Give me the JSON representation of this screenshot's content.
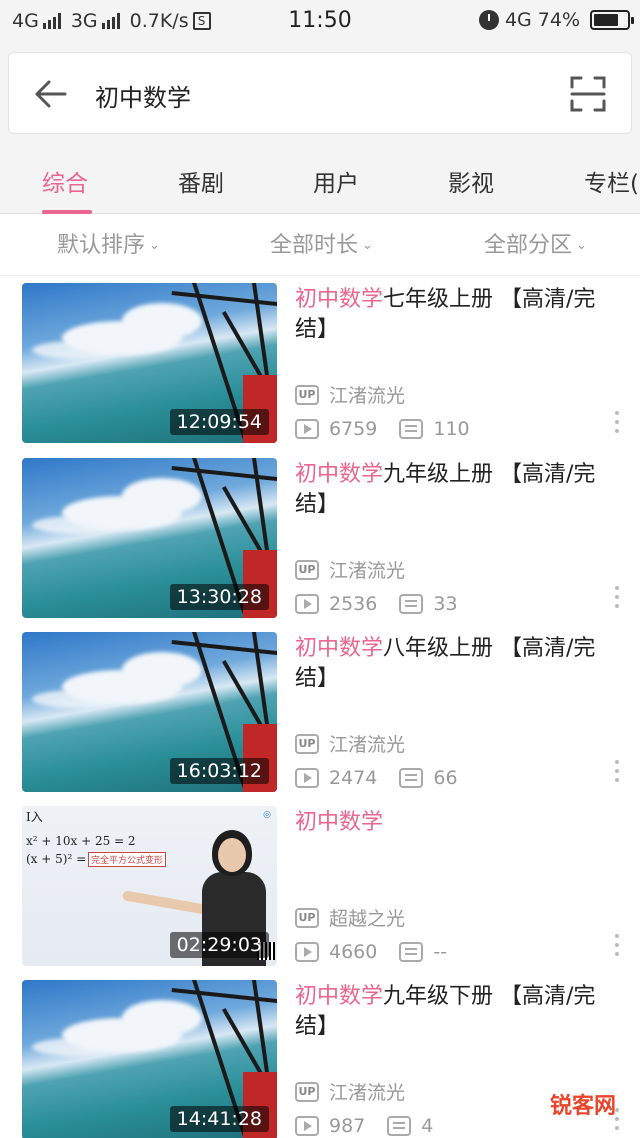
{
  "status_bar": {
    "network1": "4G",
    "network2": "3G",
    "speed": "0.7K/s",
    "s_icon": "S",
    "time": "11:50",
    "network3": "4G",
    "battery": "74%",
    "battery_level": 0.74
  },
  "search": {
    "query": "初中数学",
    "back_icon": "arrow-left-icon",
    "scan_icon": "scan-icon"
  },
  "tabs": [
    {
      "label": "综合",
      "active": true
    },
    {
      "label": "番剧"
    },
    {
      "label": "用户"
    },
    {
      "label": "影视"
    },
    {
      "label": "专栏("
    }
  ],
  "filters": [
    {
      "label": "默认排序"
    },
    {
      "label": "全部时长"
    },
    {
      "label": "全部分区"
    }
  ],
  "videos": [
    {
      "title_highlight": "初中数学",
      "title_rest": "七年级上册 【高清/完结】",
      "duration": "12:09:54",
      "up_label": "UP",
      "uploader": "江渚流光",
      "plays": "6759",
      "danmaku": "110",
      "thumb": "sky"
    },
    {
      "title_highlight": "初中数学",
      "title_rest": "九年级上册 【高清/完结】",
      "duration": "13:30:28",
      "up_label": "UP",
      "uploader": "江渚流光",
      "plays": "2536",
      "danmaku": "33",
      "thumb": "sky"
    },
    {
      "title_highlight": "初中数学",
      "title_rest": "八年级上册 【高清/完结】",
      "duration": "16:03:12",
      "up_label": "UP",
      "uploader": "江渚流光",
      "plays": "2474",
      "danmaku": "66",
      "thumb": "sky"
    },
    {
      "title_highlight": "初中数学",
      "title_rest": "",
      "duration": "02:29:03",
      "up_label": "UP",
      "uploader": "超越之光",
      "plays": "4660",
      "danmaku": "--",
      "thumb": "lesson"
    },
    {
      "title_highlight": "初中数学",
      "title_rest": "九年级下册 【高清/完结】",
      "duration": "14:41:28",
      "up_label": "UP",
      "uploader": "江渚流光",
      "plays": "987",
      "danmaku": "4",
      "thumb": "sky"
    }
  ],
  "lesson_thumb": {
    "corner_text": "I入",
    "eq1": "x² + 10x + 25 = 2",
    "eq2": "(x + 5)² = 2",
    "tag": "完全平方公式变形"
  },
  "watermark": "锐客网",
  "colors": {
    "accent": "#e8668f",
    "muted": "#999999"
  }
}
